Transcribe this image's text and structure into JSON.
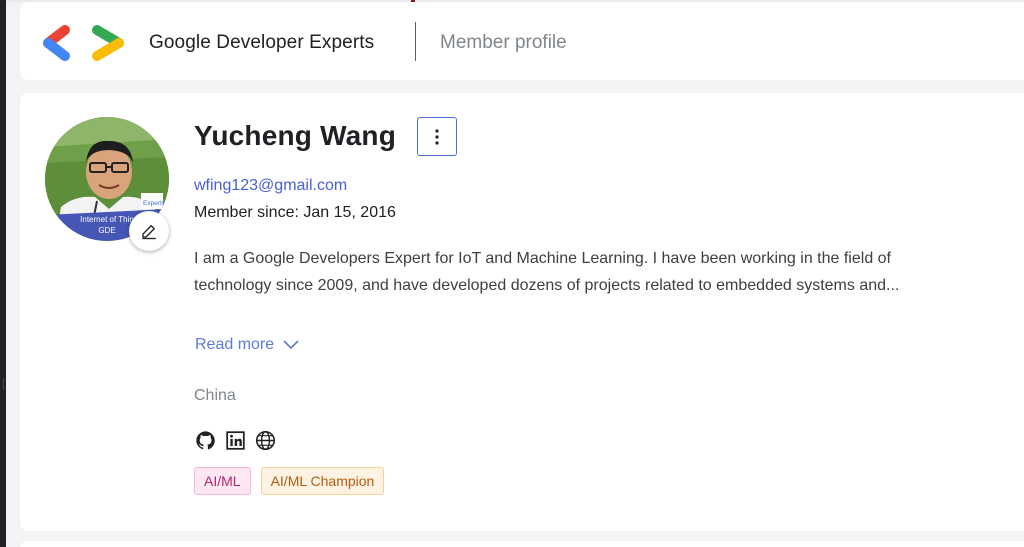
{
  "header": {
    "brand": "Google Developer Experts",
    "breadcrumb": "Member profile"
  },
  "profile": {
    "name": "Yucheng Wang",
    "email": "wfing123@gmail.com",
    "member_since": "Member since: Jan 15, 2016",
    "bio": "I am a Google Developers Expert for IoT and Machine Learning. I have been working in the field of technology since 2009, and have developed dozens of projects related to embedded systems and...",
    "read_more": "Read more",
    "location": "China",
    "avatar_banner_line1": "Internet of Thin",
    "avatar_banner_line2": "GDE",
    "avatar_badge": "Experts",
    "more_icon": "vertical-dots-icon",
    "edit_icon": "pencil-icon",
    "socials": [
      "github-icon",
      "linkedin-icon",
      "globe-icon"
    ],
    "tags": [
      {
        "label": "AI/ML",
        "color": "#b0286f"
      },
      {
        "label": "AI/ML Champion",
        "color": "#b35c10"
      }
    ]
  },
  "colors": {
    "link": "#4a5fd2",
    "logo_red": "#ea4335",
    "logo_blue": "#4285f4",
    "logo_green": "#34a853",
    "logo_yellow": "#fbbc04"
  }
}
